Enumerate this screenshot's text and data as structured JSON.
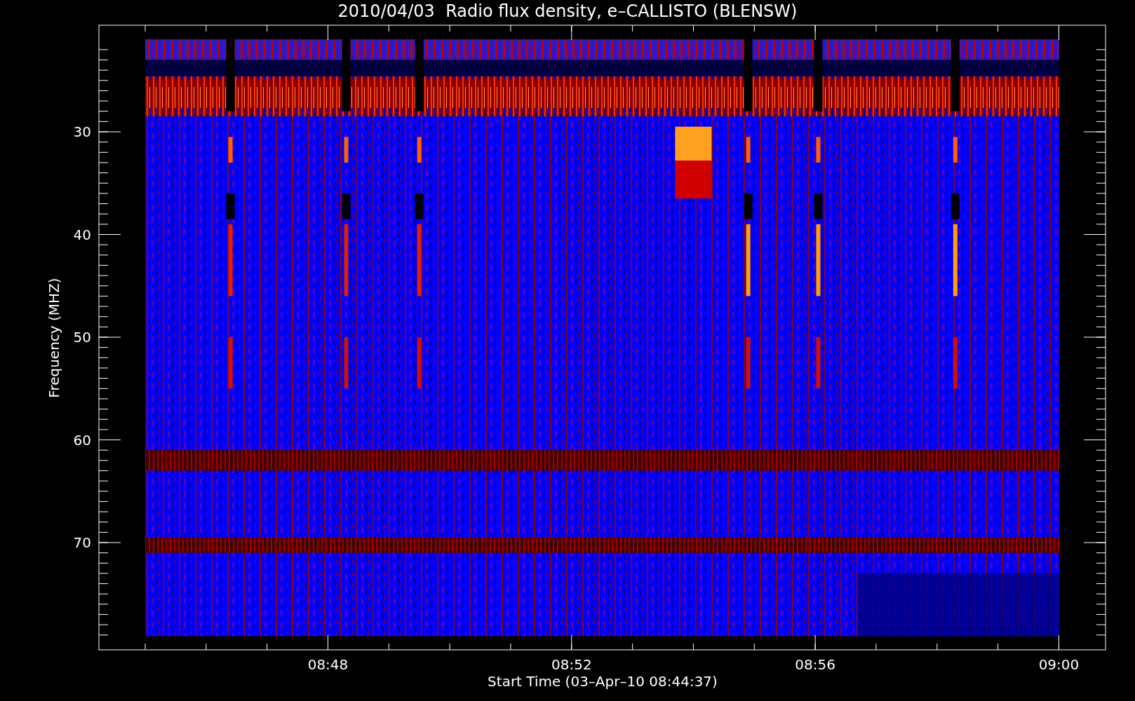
{
  "plot": {
    "title": "2010/04/03  Radio flux density, e–CALLISTO (BLENSW)",
    "x_axis": {
      "label": "Start Time (03–Apr–10 08:44:37)",
      "ticks": [
        "08:48",
        "08:52",
        "08:56",
        "09:00"
      ]
    },
    "y_axis": {
      "label": "Frequency (MHZ)",
      "ticks": [
        "30",
        "40",
        "50",
        "60",
        "70"
      ]
    }
  }
}
